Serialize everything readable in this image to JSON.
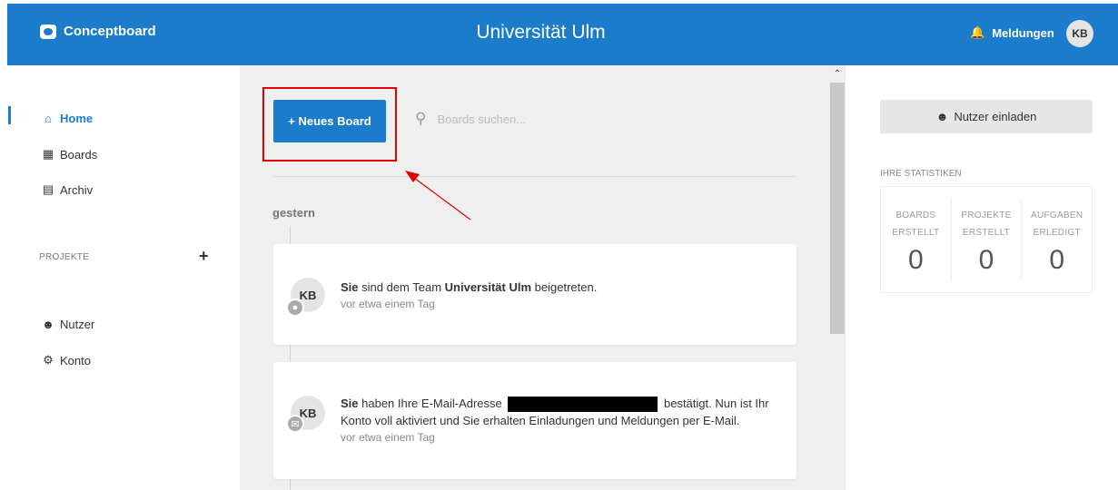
{
  "header": {
    "app_name": "Conceptboard",
    "title": "Universität Ulm",
    "notifications_label": "Meldungen",
    "avatar_initials": "KB"
  },
  "sidebar": {
    "items": [
      {
        "label": "Home",
        "icon": "home-icon",
        "active": true
      },
      {
        "label": "Boards",
        "icon": "grid-icon"
      },
      {
        "label": "Archiv",
        "icon": "archive-icon"
      }
    ],
    "projects_label": "PROJEKTE",
    "bottom_items": [
      {
        "label": "Nutzer",
        "icon": "users-icon"
      },
      {
        "label": "Konto",
        "icon": "gear-icon"
      }
    ]
  },
  "main": {
    "new_board_label": "+ Neues Board",
    "search_placeholder": "Boards suchen...",
    "day_label": "gestern",
    "activities": [
      {
        "avatar": "KB",
        "badge_icon": "user-badge-icon",
        "text_bold_1": "Sie",
        "text_1": " sind dem Team ",
        "text_bold_2": "Universität Ulm",
        "text_2": " beigetreten.",
        "time": "vor etwa einem Tag"
      },
      {
        "avatar": "KB",
        "badge_icon": "envelope-icon",
        "text_bold_1": "Sie",
        "text_1": " haben Ihre E-Mail-Adresse ",
        "text_2": " bestätigt. Nun ist Ihr",
        "text_3": "Konto voll aktiviert und Sie erhalten Einladungen und Meldungen per E-Mail.",
        "time": "vor etwa einem Tag"
      }
    ]
  },
  "right": {
    "invite_label": "Nutzer einladen",
    "stats_label": "IHRE STATISTIKEN",
    "stats": [
      {
        "line1": "BOARDS",
        "line2": "ERSTELLT",
        "value": "0"
      },
      {
        "line1": "PROJEKTE",
        "line2": "ERSTELLT",
        "value": "0"
      },
      {
        "line1": "AUFGABEN",
        "line2": "ERLEDIGT",
        "value": "0"
      }
    ]
  },
  "colors": {
    "brand": "#1a7ccb",
    "annotation": "#e00000"
  }
}
